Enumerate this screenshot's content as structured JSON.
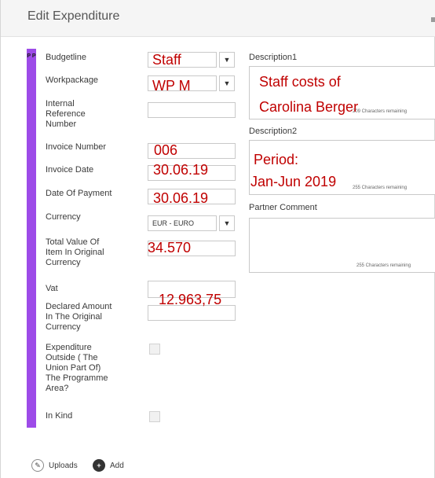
{
  "dialog": {
    "title": "Edit Expenditure"
  },
  "sidebar": {
    "label": "P P"
  },
  "fields": {
    "budgetline": {
      "label": "Budgetline",
      "value": "Staff"
    },
    "workpackage": {
      "label": "Workpackage",
      "value": "WP M"
    },
    "internal_ref": {
      "label": "Internal Reference Number",
      "value": ""
    },
    "invoice_number": {
      "label": "Invoice Number",
      "value": "006"
    },
    "invoice_date": {
      "label": "Invoice Date",
      "value": "30.06.19"
    },
    "date_of_payment": {
      "label": "Date Of Payment",
      "value": "30.06.19"
    },
    "currency": {
      "label": "Currency",
      "value": "EUR - EURO"
    },
    "total_value": {
      "label": "Total Value Of Item In Original Currency",
      "value": "34.570"
    },
    "vat": {
      "label": "Vat",
      "value": ""
    },
    "declared_amount": {
      "label": "Declared Amount In The Original Currency",
      "value": "12.963,75"
    },
    "expenditure_outside": {
      "label": "Expenditure Outside ( The Union Part Of) The Programme Area?",
      "checked": false
    },
    "in_kind": {
      "label": "In Kind",
      "checked": false
    }
  },
  "right": {
    "description1": {
      "label": "Description1",
      "line1": "Staff costs of",
      "line2": "Carolina Berger",
      "remaining": "209 Characters remaining"
    },
    "description2": {
      "label": "Description2",
      "line1": "Period:",
      "line2": "Jan-Jun 2019",
      "remaining": "255 Characters remaining"
    },
    "partner_comment": {
      "label": "Partner Comment",
      "value": "",
      "remaining": "255 Characters remaining"
    }
  },
  "footer": {
    "uploads_label": "Uploads",
    "add_label": "Add"
  },
  "icons": {
    "dropdown": "chevron-down-icon",
    "uploads": "paperclip-icon",
    "add": "plus-icon"
  },
  "colors": {
    "accent": "#9d4be8",
    "annotation": "#c00000"
  }
}
